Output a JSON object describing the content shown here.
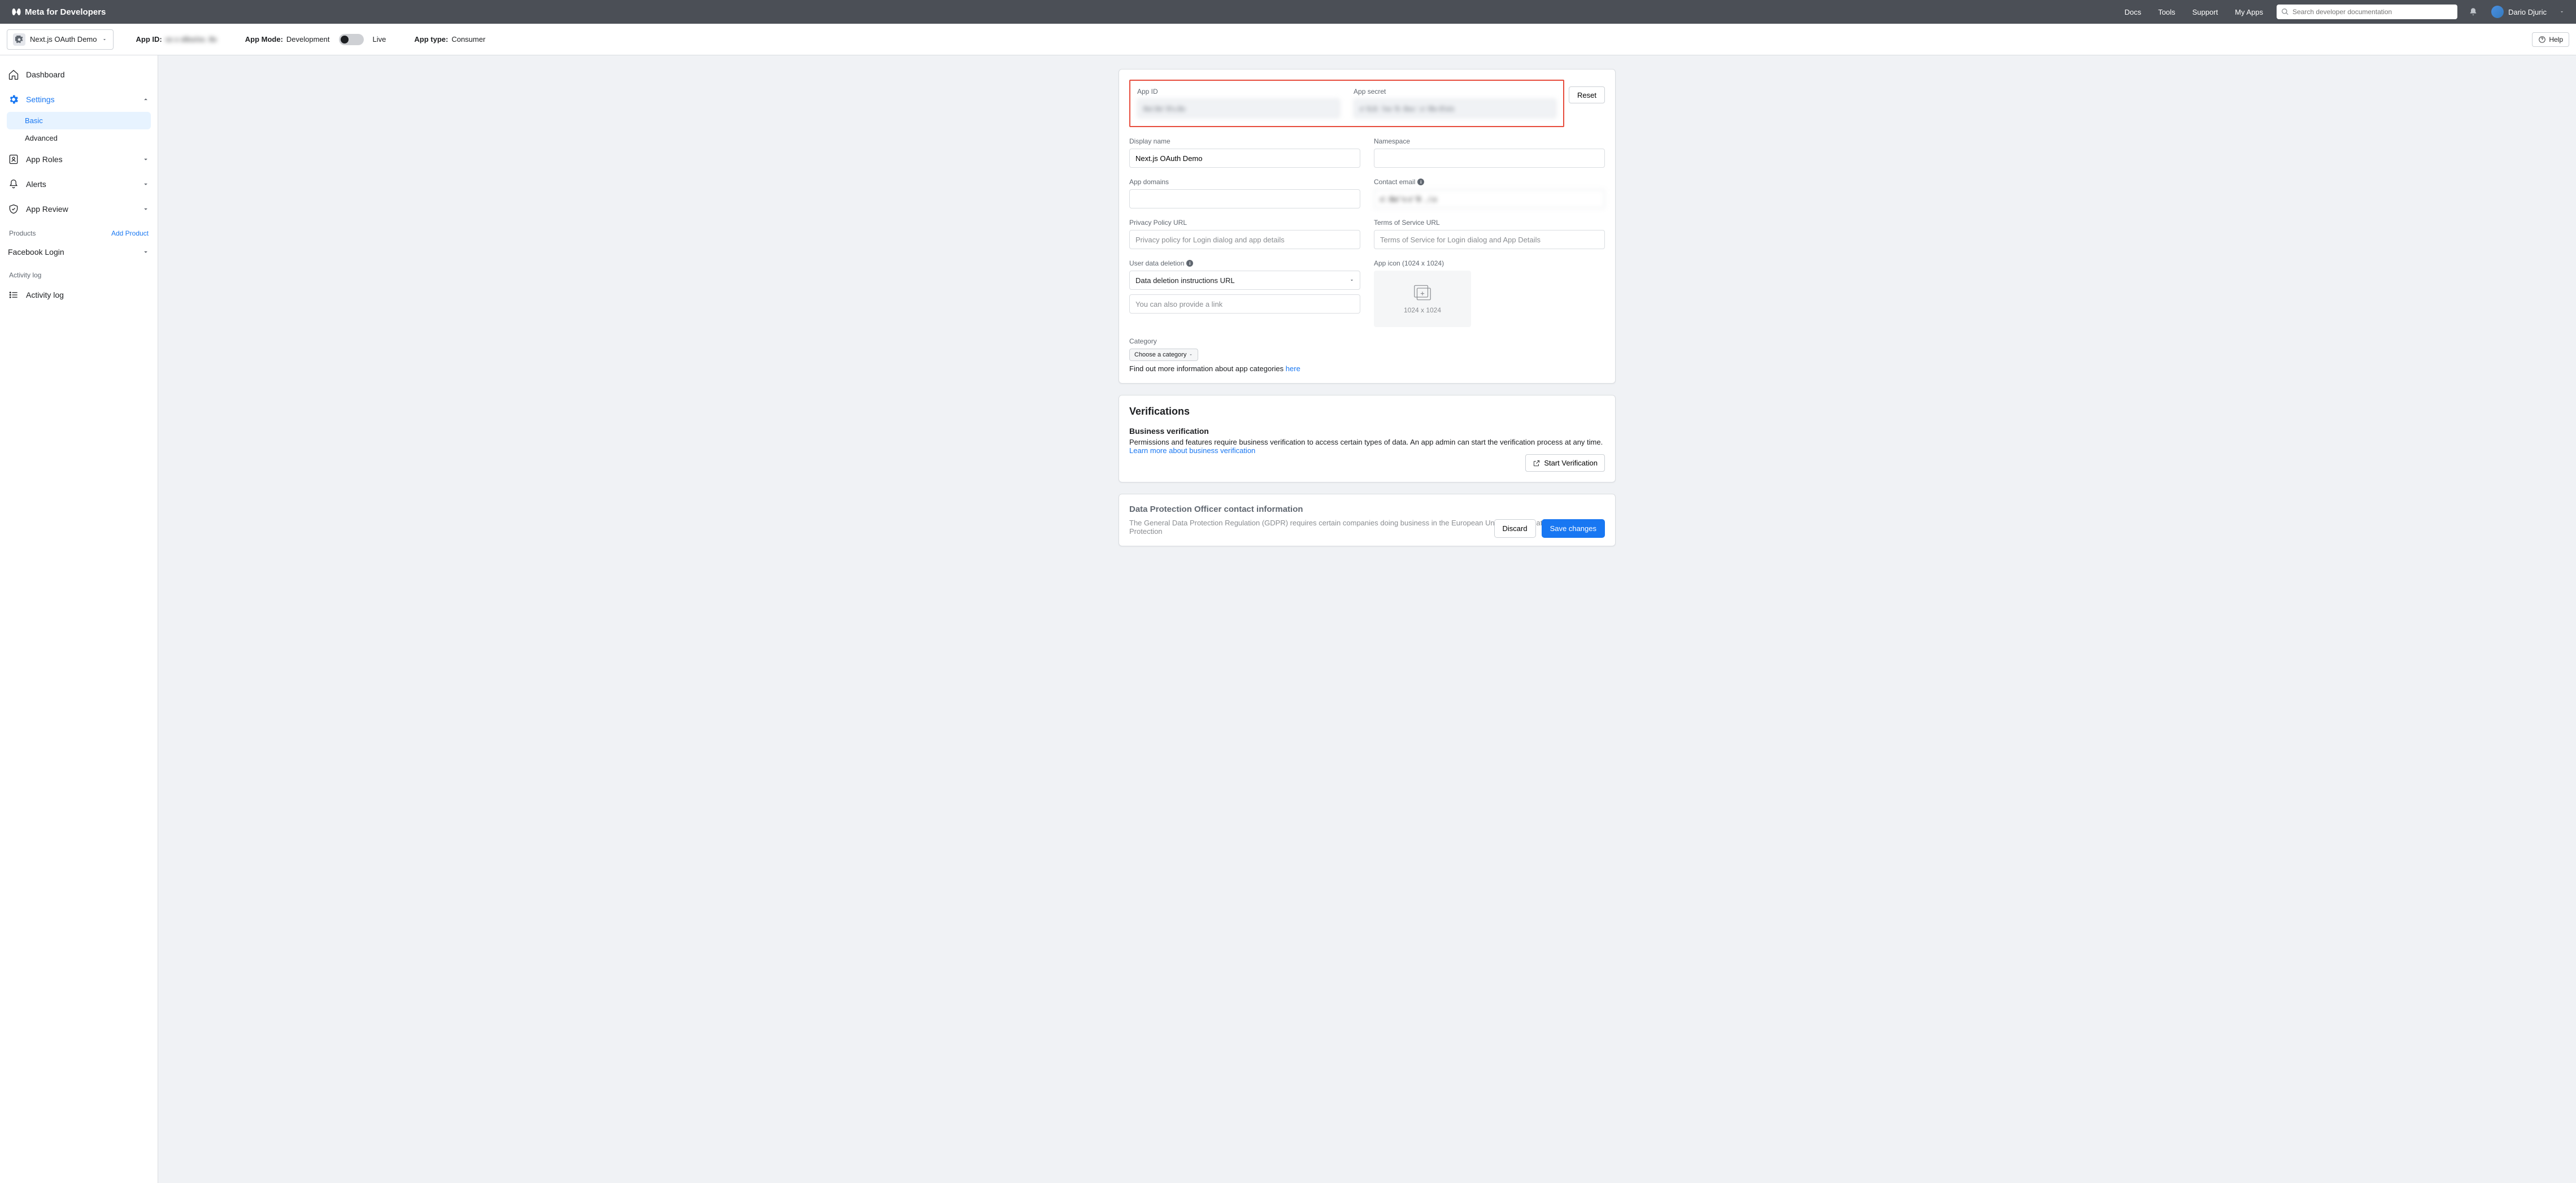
{
  "nav": {
    "brand": "Meta for Developers",
    "links": {
      "docs": "Docs",
      "tools": "Tools",
      "support": "Support",
      "myapps": "My Apps"
    },
    "search_placeholder": "Search developer documentation",
    "user_name": "Dario Djuric"
  },
  "appbar": {
    "app_name": "Next.js OAuth Demo",
    "app_id_label": "App ID:",
    "app_id_value": "xx x   x8xx/xx. 8x",
    "mode_label": "App Mode:",
    "mode_value": "Development",
    "mode_live": "Live",
    "type_label": "App type:",
    "type_value": "Consumer",
    "help": "Help"
  },
  "sidebar": {
    "dashboard": "Dashboard",
    "settings": "Settings",
    "settings_basic": "Basic",
    "settings_advanced": "Advanced",
    "app_roles": "App Roles",
    "alerts": "Alerts",
    "app_review": "App Review",
    "products_label": "Products",
    "add_product": "Add Product",
    "facebook_login": "Facebook Login",
    "activity_log_label": "Activity log",
    "activity_log": "Activity log"
  },
  "form": {
    "app_id_label": "App ID",
    "app_id_value": "8x/.8x' 8'x.8x",
    "app_secret_label": "App secret",
    "app_secret_value": "x' 8,8. '/xx '8. 8xx '.x' /8x 8'x/x",
    "reset": "Reset",
    "display_name_label": "Display name",
    "display_name_value": "Next.js OAuth Demo",
    "namespace_label": "Namespace",
    "app_domains_label": "App domains",
    "contact_email_label": "Contact email",
    "contact_email_value": "x'. 8x/ 'x x' '8  , /.x",
    "privacy_label": "Privacy Policy URL",
    "privacy_placeholder": "Privacy policy for Login dialog and app details",
    "tos_label": "Terms of Service URL",
    "tos_placeholder": "Terms of Service for Login dialog and App Details",
    "udd_label": "User data deletion",
    "udd_option": "Data deletion instructions URL",
    "udd_placeholder": "You can also provide a link",
    "icon_label": "App icon (1024 x 1024)",
    "icon_size": "1024 x 1024",
    "category_label": "Category",
    "category_option": "Choose a category",
    "category_help": "Find out more information about app categories ",
    "category_here": "here"
  },
  "verif": {
    "title": "Verifications",
    "subtitle": "Business verification",
    "desc": "Permissions and features require business verification to access certain types of data. An app admin can start the verification process at any time.",
    "link": "Learn more about business verification",
    "start": "Start Verification"
  },
  "dpo": {
    "title": "Data Protection Officer contact information",
    "desc": "The General Data Protection Regulation (GDPR) requires certain companies doing business in the European Union to designate a Data Protection"
  },
  "footer": {
    "discard": "Discard",
    "save": "Save changes"
  }
}
